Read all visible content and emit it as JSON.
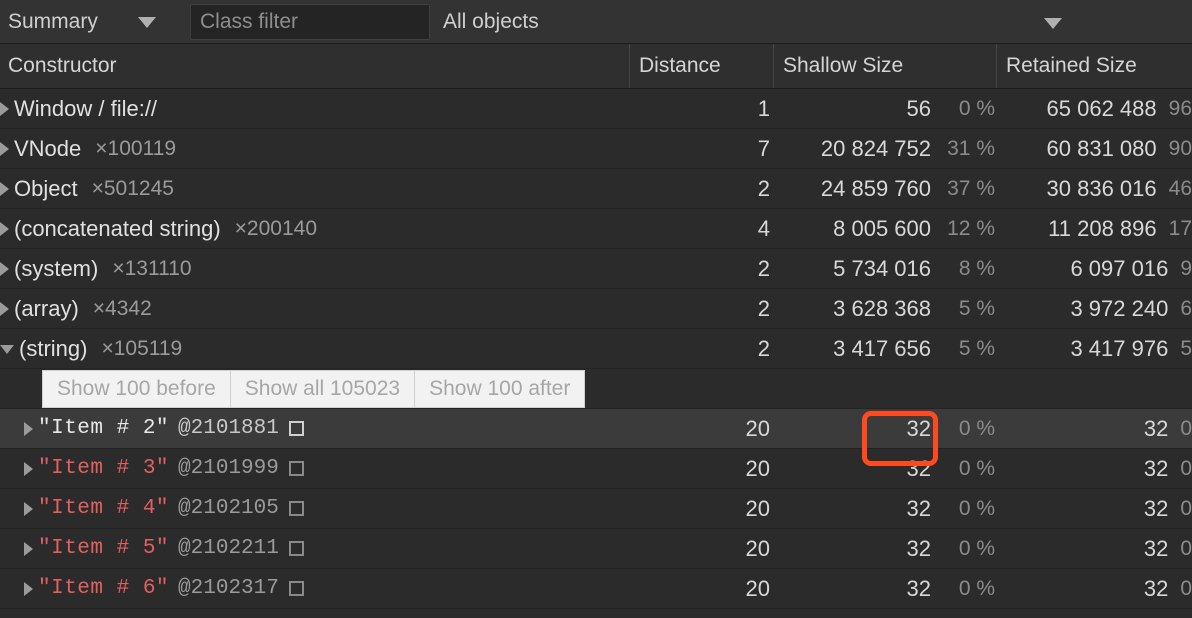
{
  "toolbar": {
    "view_select": {
      "label": "Summary",
      "icon": "chevron-down-icon"
    },
    "class_filter": {
      "value": "",
      "placeholder": "Class filter"
    },
    "scope_select": {
      "label": "All objects",
      "icon": "chevron-down-icon"
    }
  },
  "table": {
    "columns": [
      {
        "key": "constructor",
        "label": "Constructor"
      },
      {
        "key": "distance",
        "label": "Distance"
      },
      {
        "key": "shallow",
        "label": "Shallow Size"
      },
      {
        "key": "retained",
        "label": "Retained Size"
      }
    ],
    "rows": [
      {
        "kind": "class",
        "disclosure": "collapsed",
        "name": "Window / file://",
        "count": "",
        "distance": "1",
        "shallow": "56",
        "shallow_pct": "0 %",
        "retained": "65 062 488",
        "retained_pct": "96"
      },
      {
        "kind": "class",
        "disclosure": "collapsed",
        "name": "VNode",
        "count": "×100119",
        "distance": "7",
        "shallow": "20 824 752",
        "shallow_pct": "31 %",
        "retained": "60 831 080",
        "retained_pct": "90"
      },
      {
        "kind": "class",
        "disclosure": "collapsed",
        "name": "Object",
        "count": "×501245",
        "distance": "2",
        "shallow": "24 859 760",
        "shallow_pct": "37 %",
        "retained": "30 836 016",
        "retained_pct": "46"
      },
      {
        "kind": "class",
        "disclosure": "collapsed",
        "name": "(concatenated string)",
        "count": "×200140",
        "distance": "4",
        "shallow": "8 005 600",
        "shallow_pct": "12 %",
        "retained": "11 208 896",
        "retained_pct": "17"
      },
      {
        "kind": "class",
        "disclosure": "collapsed",
        "name": "(system)",
        "count": "×131110",
        "distance": "2",
        "shallow": "5 734 016",
        "shallow_pct": "8 %",
        "retained": "6 097 016",
        "retained_pct": "9"
      },
      {
        "kind": "class",
        "disclosure": "collapsed",
        "name": "(array)",
        "count": "×4342",
        "distance": "2",
        "shallow": "3 628 368",
        "shallow_pct": "5 %",
        "retained": "3 972 240",
        "retained_pct": "6"
      },
      {
        "kind": "class",
        "disclosure": "expanded",
        "name": "(string)",
        "count": "×105119",
        "distance": "2",
        "shallow": "3 417 656",
        "shallow_pct": "5 %",
        "retained": "3 417 976",
        "retained_pct": "5"
      }
    ],
    "show_more": {
      "buttons": [
        {
          "label": "Show 100 before"
        },
        {
          "label": "Show all 105023"
        },
        {
          "label": "Show 100 after"
        }
      ]
    },
    "object_rows": [
      {
        "disclosure": "collapsed",
        "selected": true,
        "name": "\"Item # 2\"",
        "id": "@2101881",
        "icon": "object-preview-icon",
        "distance": "20",
        "shallow": "32",
        "shallow_pct": "0 %",
        "retained": "32",
        "retained_pct": "0"
      },
      {
        "disclosure": "collapsed",
        "selected": false,
        "name": "\"Item # 3\"",
        "id": "@2101999",
        "icon": "object-preview-icon",
        "distance": "20",
        "shallow": "32",
        "shallow_pct": "0 %",
        "retained": "32",
        "retained_pct": "0"
      },
      {
        "disclosure": "collapsed",
        "selected": false,
        "name": "\"Item # 4\"",
        "id": "@2102105",
        "icon": "object-preview-icon",
        "distance": "20",
        "shallow": "32",
        "shallow_pct": "0 %",
        "retained": "32",
        "retained_pct": "0"
      },
      {
        "disclosure": "collapsed",
        "selected": false,
        "name": "\"Item # 5\"",
        "id": "@2102211",
        "icon": "object-preview-icon",
        "distance": "20",
        "shallow": "32",
        "shallow_pct": "0 %",
        "retained": "32",
        "retained_pct": "0"
      },
      {
        "disclosure": "collapsed",
        "selected": false,
        "name": "\"Item # 6\"",
        "id": "@2102317",
        "icon": "object-preview-icon",
        "distance": "20",
        "shallow": "32",
        "shallow_pct": "0 %",
        "retained": "32",
        "retained_pct": "0"
      }
    ]
  },
  "annotation": {
    "type": "highlight-rectangle",
    "color": "#ff4a20",
    "target": "shallow-size-value-of-selected-row",
    "value": "32"
  },
  "colors": {
    "toolbar_bg": "#333333",
    "grid_bg": "#2b2b2b",
    "header_bg": "#2f2f2f",
    "selected_row_bg": "#3b3b3b",
    "string_value": "#e26060",
    "muted_text": "#9a9a9a",
    "primary_text": "#e0e0e0",
    "highlight": "#ff4a20"
  }
}
